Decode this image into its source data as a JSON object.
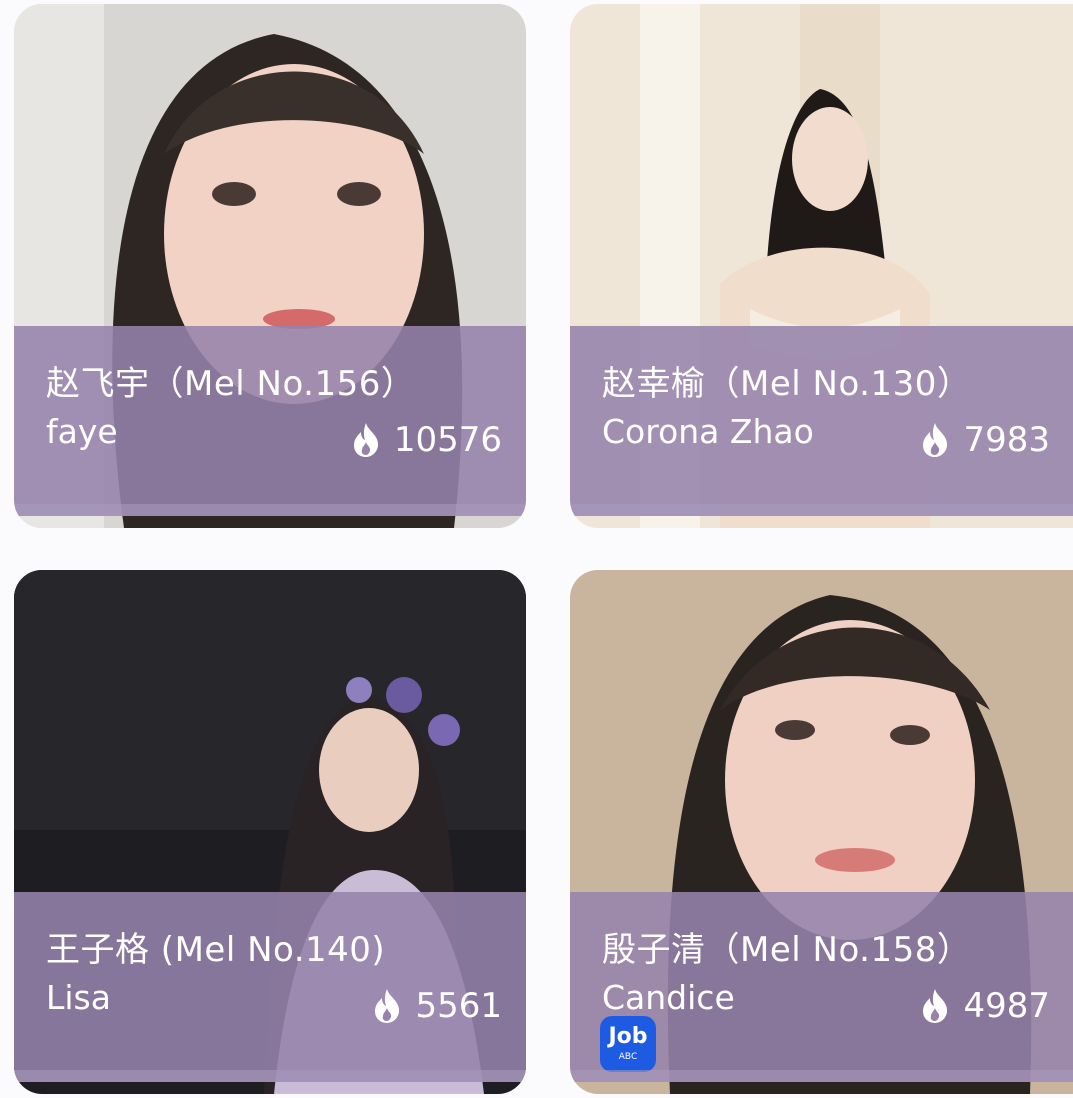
{
  "cards": [
    {
      "cn_name": "赵飞宇（Mel No.156）",
      "en_name": "faye",
      "heat": "10576",
      "icon": "flame-icon"
    },
    {
      "cn_name": "赵幸榆（Mel No.130）",
      "en_name": "Corona Zhao",
      "heat": "7983",
      "icon": "flame-icon"
    },
    {
      "cn_name": "王子格 (Mel No.140)",
      "en_name": "Lisa",
      "heat": "5561",
      "icon": "flame-icon"
    },
    {
      "cn_name": "殷子清（Mel No.158）",
      "en_name": "Candice",
      "heat": "4987",
      "icon": "flame-icon"
    }
  ],
  "badge": {
    "line1": "Job",
    "line2": "ABC"
  },
  "colors": {
    "overlay": "#9683ac",
    "badge": "#1d5be3",
    "background": "#fbfafc"
  }
}
